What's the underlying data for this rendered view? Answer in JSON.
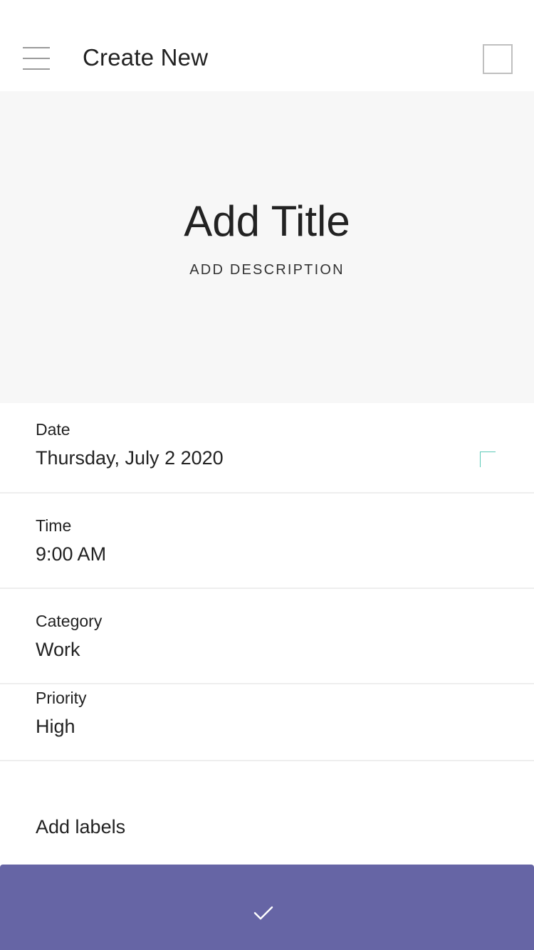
{
  "header": {
    "title": "Create New"
  },
  "hero": {
    "title": "Add Title",
    "description": "ADD DESCRIPTION"
  },
  "fields": {
    "date": {
      "label": "Date",
      "value": "Thursday, July 2 2020"
    },
    "time": {
      "label": "Time",
      "value": "9:00 AM"
    },
    "category": {
      "label": "Category",
      "value": "Work"
    },
    "priority": {
      "label": "Priority",
      "value": "High"
    }
  },
  "labels": {
    "add_label": "Add labels"
  },
  "icons": {
    "menu": "menu-icon",
    "header_action": "square-outline-icon",
    "picker": "corner-marker-icon",
    "confirm": "check-icon"
  },
  "colors": {
    "confirm_bar": "#6665a5",
    "hero_background": "#f7f7f7",
    "accent_marker": "#5cc9b8"
  }
}
